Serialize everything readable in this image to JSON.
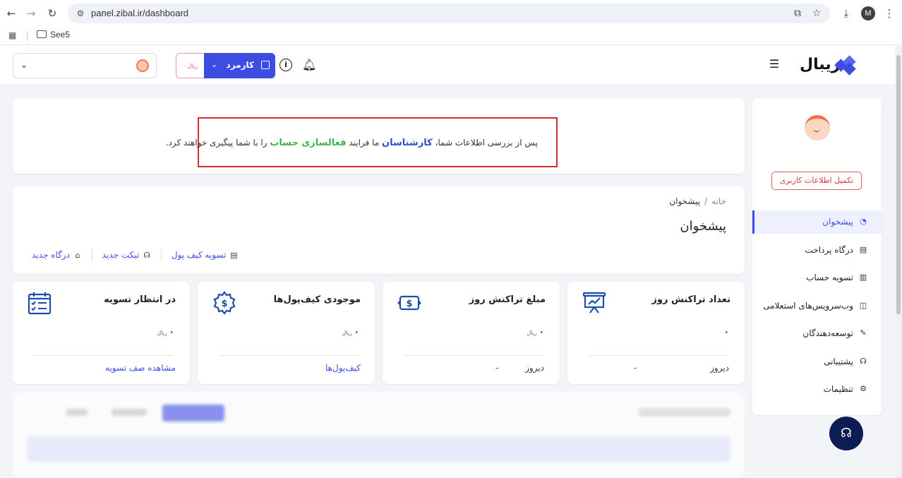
{
  "browser": {
    "url": "panel.zibal.ir/dashboard",
    "bookmark_folder": "See5",
    "profile_initial": "M"
  },
  "header": {
    "balance": "۰ ریال",
    "karmozd_label": "کارمزد",
    "logo_text": "زیبال"
  },
  "notice": {
    "part1": "پس از بررسی اطلاعات شما، ",
    "expert": "کارشناسان",
    "part2": " ما فرایند ",
    "activation": "فعالسازی حساب",
    "part3": " را با شما پیگیری خواهند کرد."
  },
  "page": {
    "breadcrumb_home": "خانه",
    "breadcrumb_sep": "/",
    "breadcrumb_current": "پیشخوان",
    "title": "پیشخوان",
    "actions": {
      "wallet_settle": "تسویه کیف پول",
      "new_ticket": "تیکت جدید",
      "new_gateway": "درگاه جدید"
    }
  },
  "stats": {
    "daily_count": {
      "title": "تعداد تراکنش روز",
      "value": "۰",
      "yesterday_label": "دیروز",
      "yesterday_value": "-"
    },
    "daily_amount": {
      "title": "مبلغ تراکنش روز",
      "value": "۰",
      "unit": "ریال",
      "yesterday_label": "دیروز",
      "yesterday_value": "-"
    },
    "wallet_balance": {
      "title": "موجودی کیف‌پول‌ها",
      "value": "۰",
      "unit": "ریال",
      "link": "کیف‌پول‌ها"
    },
    "pending_settle": {
      "title": "در انتظار تسویه",
      "value": "۰",
      "unit": "ریال",
      "link": "مشاهده صف تسویه"
    }
  },
  "sidebar": {
    "complete_profile": "تکمیل اطلاعات کاربری",
    "items": [
      {
        "label": "پیشخوان",
        "icon": "dashboard-icon"
      },
      {
        "label": "درگاه پرداخت",
        "icon": "gateway-icon"
      },
      {
        "label": "تسویه حساب",
        "icon": "settlement-icon"
      },
      {
        "label": "وب‌سرویس‌های استعلامی",
        "icon": "webservice-icon"
      },
      {
        "label": "توسعه‌دهندگان",
        "icon": "wrench-icon"
      },
      {
        "label": "پشتیبانی",
        "icon": "headset-icon"
      },
      {
        "label": "تنظیمات",
        "icon": "gear-icon"
      }
    ]
  },
  "colors": {
    "accent": "#3d4de3",
    "danger": "#d32f2f",
    "success": "#3bb54a"
  }
}
